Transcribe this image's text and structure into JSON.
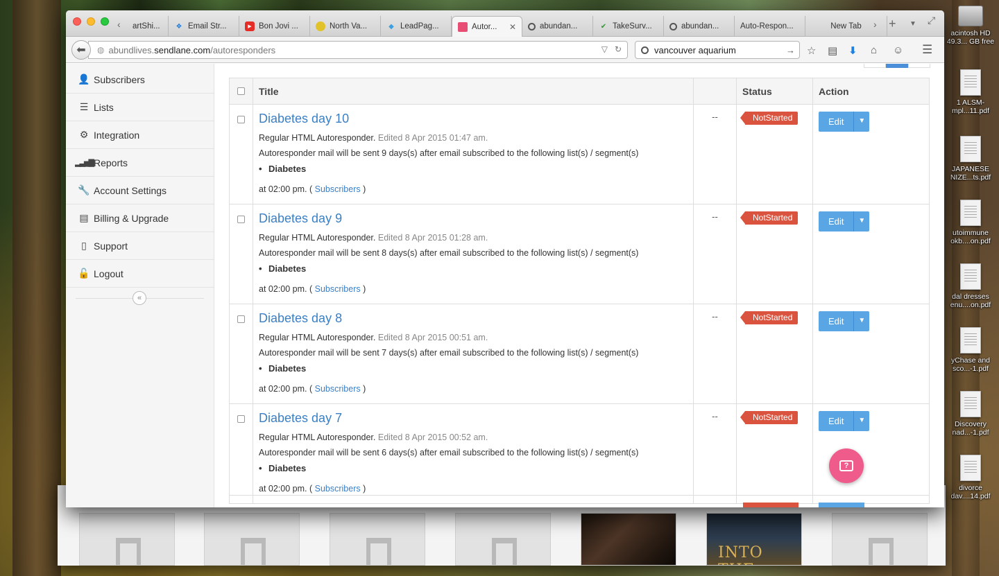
{
  "desktop": {
    "icons": [
      {
        "label": "acintosh HD",
        "sub": "49.3... GB free"
      },
      {
        "label": "1 ALSM-",
        "sub": "mpl...11.pdf"
      },
      {
        "label": "JAPANESE",
        "sub": "NIZE...ts.pdf"
      },
      {
        "label": "utoimmune",
        "sub": "okb....on.pdf"
      },
      {
        "label": "dal dresses",
        "sub": "enu....on.pdf"
      },
      {
        "label": "yChase and",
        "sub": "sco...-1.pdf"
      },
      {
        "label": "Discovery",
        "sub": "nad...-1.pdf"
      },
      {
        "label": "divorce",
        "sub": "dav....14.pdf"
      }
    ],
    "poster_text": "INTO THE"
  },
  "browser": {
    "tabs": [
      {
        "label": "artShi...",
        "icon": "generic"
      },
      {
        "label": "Email Str...",
        "icon": "dropbox"
      },
      {
        "label": "Bon Jovi ...",
        "icon": "youtube"
      },
      {
        "label": "North Va...",
        "icon": "shell"
      },
      {
        "label": "LeadPag...",
        "icon": "leadpages"
      },
      {
        "label": "Autor...",
        "icon": "sendlane",
        "active": true
      },
      {
        "label": "abundan...",
        "icon": "search"
      },
      {
        "label": "TakeSurv...",
        "icon": "check"
      },
      {
        "label": "abundan...",
        "icon": "search"
      },
      {
        "label": "Auto-Respon...",
        "icon": "none"
      },
      {
        "label": "New Tab",
        "icon": "none"
      }
    ],
    "url": {
      "prefix": "abundlives.",
      "host": "sendlane.com",
      "path": "/autoresponders"
    },
    "search_value": "vancouver aquarium"
  },
  "sidebar": {
    "items": [
      {
        "label": "Subscribers",
        "icon": "user-plus-icon"
      },
      {
        "label": "Lists",
        "icon": "list-icon"
      },
      {
        "label": "Integration",
        "icon": "gear-icon"
      },
      {
        "label": "Reports",
        "icon": "signal-icon"
      },
      {
        "label": "Account Settings",
        "icon": "wrench-icon"
      },
      {
        "label": "Billing & Upgrade",
        "icon": "document-icon"
      },
      {
        "label": "Support",
        "icon": "phone-icon"
      },
      {
        "label": "Logout",
        "icon": "unlock-icon"
      }
    ],
    "collapse_glyph": "«"
  },
  "table": {
    "headers": {
      "title": "Title",
      "blank": "",
      "status": "Status",
      "action": "Action"
    },
    "rows": [
      {
        "title": "Diabetes day 10",
        "type": "Regular HTML Autoresponder.",
        "edited": "Edited 8 Apr 2015 01:47 am.",
        "desc": "Autoresponder mail will be sent 9 days(s) after email subscribed to the following list(s) / segment(s)",
        "list": "Diabetes",
        "at": "at 02:00 pm. (",
        "link": "Subscribers",
        "close": ")",
        "dash": "--",
        "status": "NotStarted",
        "action": "Edit"
      },
      {
        "title": "Diabetes day 9",
        "type": "Regular HTML Autoresponder.",
        "edited": "Edited 8 Apr 2015 01:28 am.",
        "desc": "Autoresponder mail will be sent 8 days(s) after email subscribed to the following list(s) / segment(s)",
        "list": "Diabetes",
        "at": "at 02:00 pm. (",
        "link": "Subscribers",
        "close": ")",
        "dash": "--",
        "status": "NotStarted",
        "action": "Edit"
      },
      {
        "title": "Diabetes day 8",
        "type": "Regular HTML Autoresponder.",
        "edited": "Edited 8 Apr 2015 00:51 am.",
        "desc": "Autoresponder mail will be sent 7 days(s) after email subscribed to the following list(s) / segment(s)",
        "list": "Diabetes",
        "at": "at 02:00 pm. (",
        "link": "Subscribers",
        "close": ")",
        "dash": "--",
        "status": "NotStarted",
        "action": "Edit"
      },
      {
        "title": "Diabetes day 7",
        "type": "Regular HTML Autoresponder.",
        "edited": "Edited 8 Apr 2015 00:52 am.",
        "desc": "Autoresponder mail will be sent 6 days(s) after email subscribed to the following list(s) / segment(s)",
        "list": "Diabetes",
        "at": "at 02:00 pm. (",
        "link": "Subscribers",
        "close": ")",
        "dash": "--",
        "status": "NotStarted",
        "action": "Edit"
      }
    ]
  },
  "colors": {
    "link": "#3a7fc4",
    "status_badge": "#d9533f",
    "edit_button": "#5aa5e3",
    "help_fab": "#ef5b8a"
  }
}
